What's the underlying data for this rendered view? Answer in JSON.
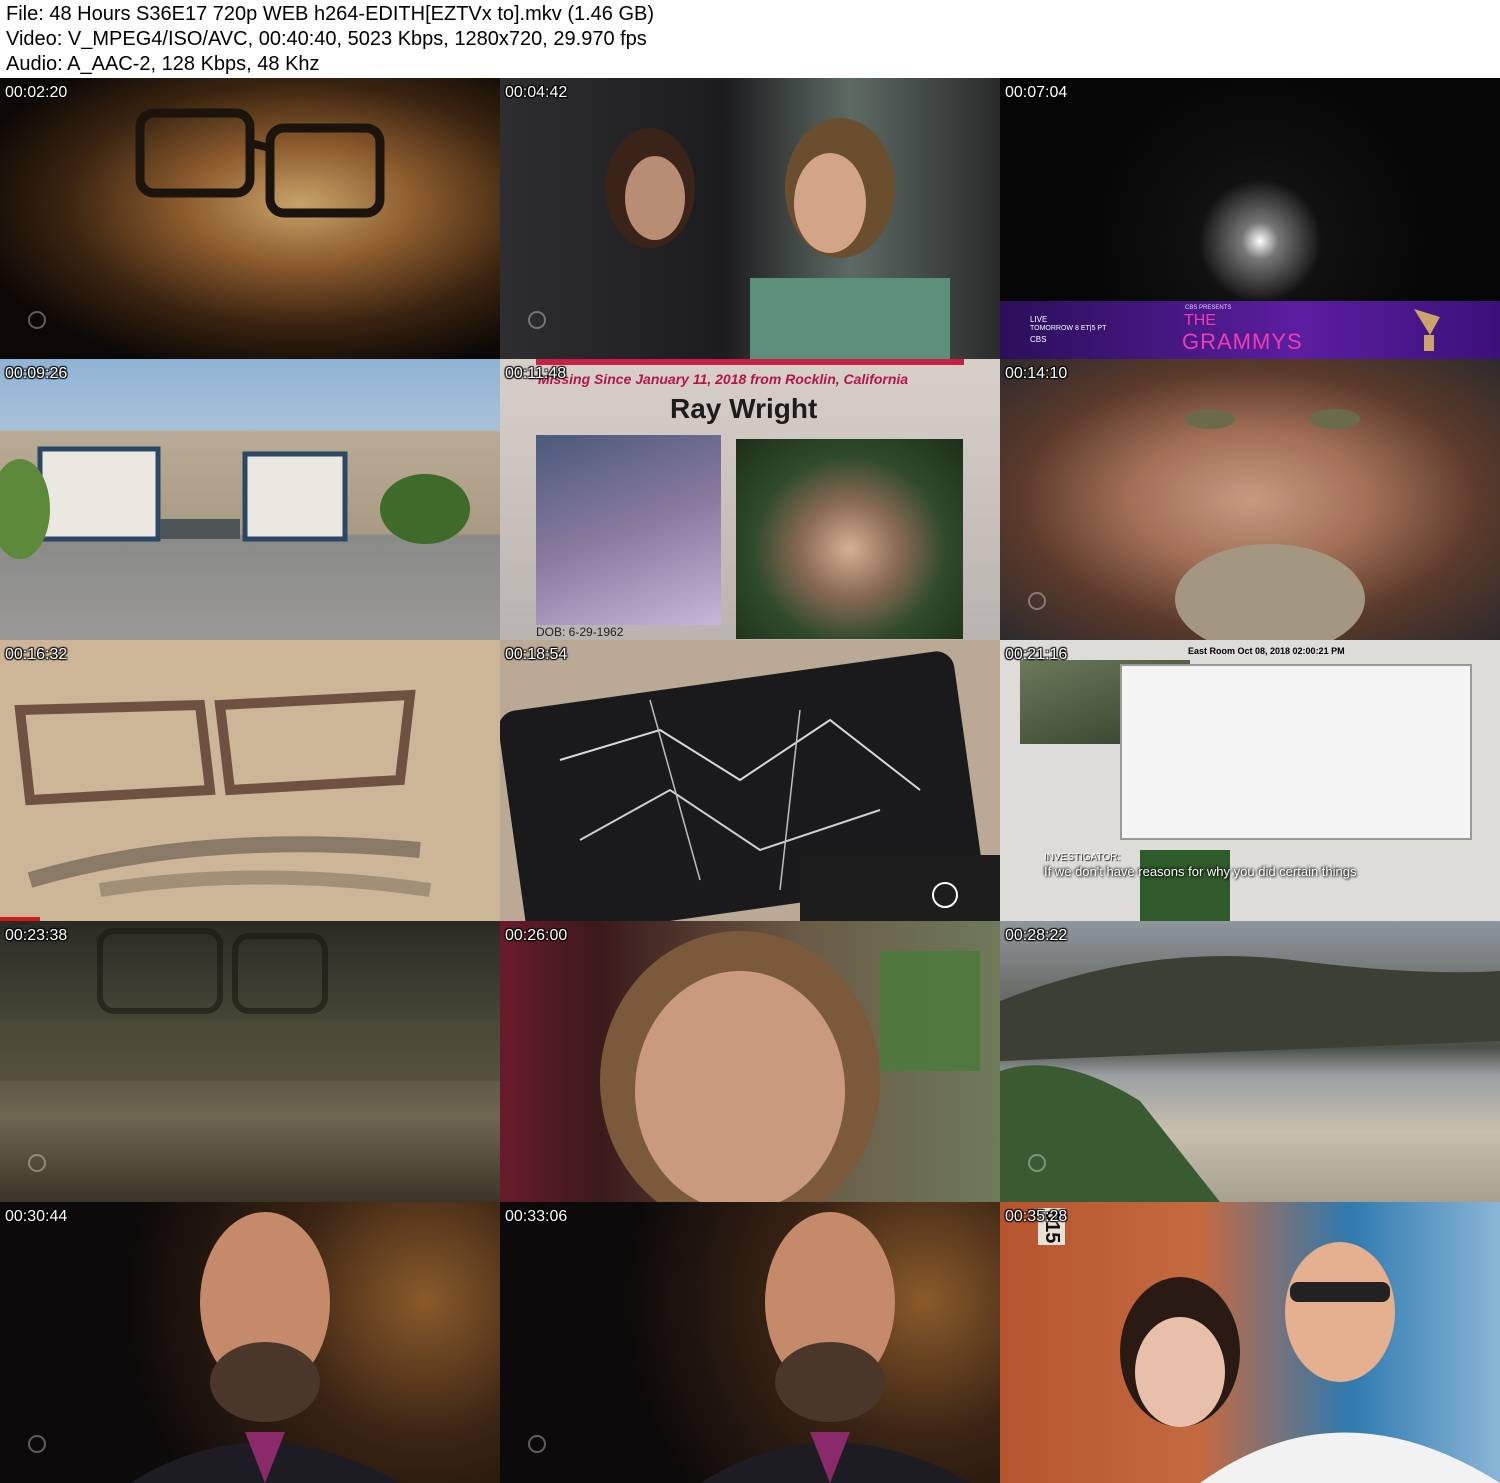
{
  "header": {
    "file_line": "File: 48 Hours S36E17 720p WEB h264-EDITH[EZTVx to].mkv (1.46 GB)",
    "video_line": "Video: V_MPEG4/ISO/AVC, 00:40:40, 5023 Kbps, 1280x720, 29.970 fps",
    "audio_line": "Audio: A_AAC-2, 128 Kbps, 48 Khz"
  },
  "thumbnails": [
    {
      "timestamp": "00:02:20"
    },
    {
      "timestamp": "00:04:42"
    },
    {
      "timestamp": "00:07:04",
      "promo": {
        "live": "LIVE",
        "when": "TOMORROW 8 ET|5 PT",
        "network": "CBS",
        "presents": "CBS PRESENTS",
        "the": "THE",
        "title": "GRAMMYS"
      }
    },
    {
      "timestamp": "00:09:26"
    },
    {
      "timestamp": "00:11:48",
      "poster": {
        "banner": "Missing Since January 11, 2018 from Rocklin, California",
        "name": "Ray Wright",
        "dob": "DOB: 6-29-1962"
      }
    },
    {
      "timestamp": "00:14:10"
    },
    {
      "timestamp": "00:16:32"
    },
    {
      "timestamp": "00:18:54"
    },
    {
      "timestamp": "00:21:16",
      "cctv": {
        "stamp": "East Room   Oct 08, 2018   02:00:21 PM",
        "speaker": "INVESTIGATOR:",
        "caption": "If we don't have reasons for why you did certain things"
      }
    },
    {
      "timestamp": "00:23:38"
    },
    {
      "timestamp": "00:26:00"
    },
    {
      "timestamp": "00:28:22"
    },
    {
      "timestamp": "00:30:44"
    },
    {
      "timestamp": "00:33:06"
    },
    {
      "timestamp": "00:35:28",
      "sign": "615"
    }
  ]
}
